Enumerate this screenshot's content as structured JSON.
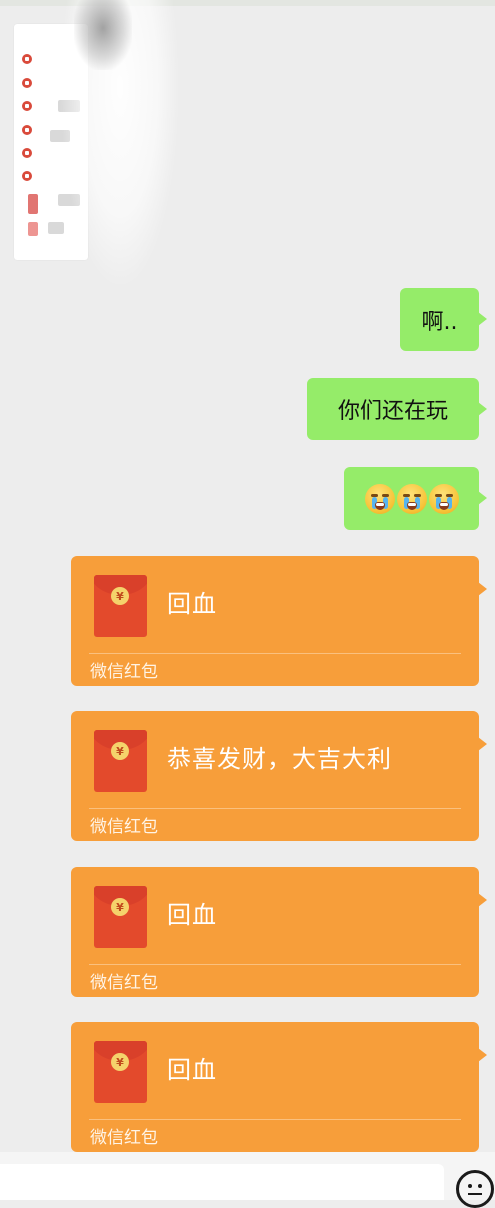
{
  "chat": {
    "messages": [
      {
        "type": "text",
        "side": "right",
        "text": "啊.."
      },
      {
        "type": "text",
        "side": "right",
        "text": "你们还在玩"
      },
      {
        "type": "emoji",
        "side": "right",
        "emoji": [
          "crying-face-icon",
          "crying-face-icon",
          "crying-face-icon"
        ]
      },
      {
        "type": "red_packet",
        "side": "right",
        "title": "回血",
        "footer": "微信红包"
      },
      {
        "type": "red_packet",
        "side": "right",
        "title": "恭喜发财，大吉大利",
        "footer": "微信红包"
      },
      {
        "type": "red_packet",
        "side": "right",
        "title": "回血",
        "footer": "微信红包"
      },
      {
        "type": "red_packet",
        "side": "right",
        "title": "回血",
        "footer": "微信红包"
      }
    ]
  },
  "packet_icon_symbol": "¥",
  "colors": {
    "background": "#ededed",
    "bubble_green": "#95ec69",
    "red_packet": "#f79e3a",
    "red_packet_icon": "#e34a2c"
  },
  "input_bar": {
    "emoji_button_icon": "emoji-face-icon"
  }
}
